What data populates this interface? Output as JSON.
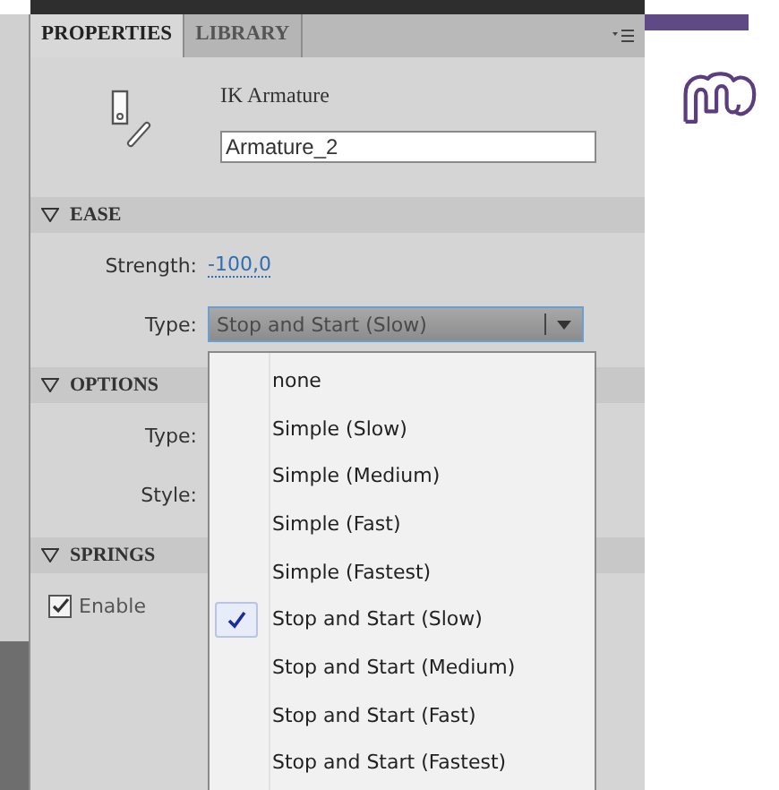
{
  "tabs": [
    {
      "label": "PROPERTIES",
      "selected": true
    },
    {
      "label": "LIBRARY",
      "selected": false
    }
  ],
  "header": {
    "title": "IK Armature",
    "name_value": "Armature_2"
  },
  "sections": [
    {
      "title": "EASE",
      "expanded": true,
      "rows": [
        {
          "kind": "link",
          "label": "Strength:",
          "value": "-100,0"
        },
        {
          "kind": "dropdown",
          "label": "Type:",
          "value": "Stop and Start (Slow)"
        }
      ]
    },
    {
      "title": "OPTIONS",
      "expanded": true,
      "rows": [
        {
          "kind": "label",
          "label": "Type:"
        },
        {
          "kind": "label",
          "label": "Style:"
        }
      ]
    },
    {
      "title": "SPRINGS",
      "expanded": true,
      "rows": [
        {
          "kind": "checkbox",
          "label": "Enable",
          "checked": true
        }
      ]
    }
  ],
  "dropdown_menu": {
    "items": [
      {
        "label": "none",
        "selected": false
      },
      {
        "label": "Simple (Slow)",
        "selected": false
      },
      {
        "label": "Simple (Medium)",
        "selected": false
      },
      {
        "label": "Simple (Fast)",
        "selected": false
      },
      {
        "label": "Simple (Fastest)",
        "selected": false
      },
      {
        "label": "Stop and Start (Slow)",
        "selected": true
      },
      {
        "label": "Stop and Start (Medium)",
        "selected": false
      },
      {
        "label": "Stop and Start (Fast)",
        "selected": false
      },
      {
        "label": "Stop and Start (Fastest)",
        "selected": false
      }
    ]
  }
}
